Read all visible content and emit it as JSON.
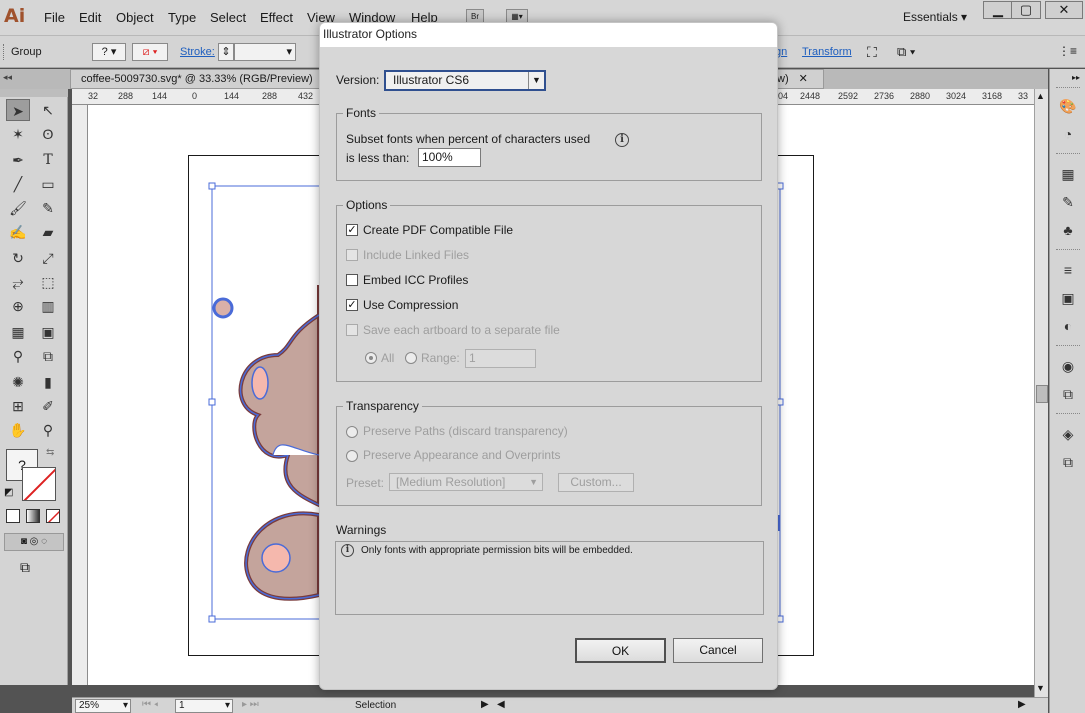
{
  "app": {
    "logo": "Ai"
  },
  "menu": {
    "items": [
      "File",
      "Edit",
      "Object",
      "Type",
      "Select",
      "Effect",
      "View",
      "Window",
      "Help"
    ],
    "bridge_label": "Br",
    "workspace": "Essentials ▾"
  },
  "control_bar": {
    "group_label": "Group",
    "stroke_label": "Stroke:",
    "fill_q": "?",
    "link_partial": "gn",
    "transform_label": "Transform"
  },
  "document": {
    "tab_title": "coffee-5009730.svg* @ 33.33% (RGB/Preview)",
    "tab2_label": "w)"
  },
  "ruler": {
    "h_left": [
      "32",
      "288",
      "144",
      "0",
      "144",
      "288",
      "432"
    ],
    "h_right": [
      "04",
      "2448",
      "2592",
      "2736",
      "2880",
      "3024",
      "3168",
      "33"
    ]
  },
  "status": {
    "zoom": "25%",
    "page": "1",
    "mode": "Selection"
  },
  "dialog": {
    "title": "Illustrator Options",
    "version_label": "Version:",
    "version_value": "Illustrator CS6",
    "fonts": {
      "group_label": "Fonts",
      "line1": "Subset fonts when percent of characters used",
      "line2": "is less than:",
      "percent": "100%"
    },
    "options": {
      "group_label": "Options",
      "create_pdf": "Create PDF Compatible File",
      "include_linked": "Include Linked Files",
      "embed_icc": "Embed ICC Profiles",
      "use_compression": "Use Compression",
      "save_each": "Save each artboard to a separate file",
      "all_label": "All",
      "range_label": "Range:",
      "range_value": "1"
    },
    "transparency": {
      "group_label": "Transparency",
      "preserve_paths": "Preserve Paths (discard transparency)",
      "preserve_appearance": "Preserve Appearance and Overprints",
      "preset_label": "Preset:",
      "preset_value": "[Medium Resolution]",
      "custom_label": "Custom..."
    },
    "warnings": {
      "label": "Warnings",
      "message": "Only fonts with appropriate permission bits will be embedded."
    },
    "ok_label": "OK",
    "cancel_label": "Cancel"
  }
}
